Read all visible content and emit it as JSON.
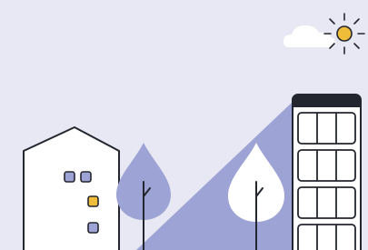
{
  "colors": {
    "background": "#e7e8f3",
    "accent_blue": "#9da3d4",
    "accent_yellow": "#efbd3a",
    "outline": "#24262f",
    "building_fill": "#ffffff",
    "cloud_fill": "#ffffff"
  },
  "icons": {
    "sun": "sun-icon",
    "cloud": "cloud-icon"
  }
}
